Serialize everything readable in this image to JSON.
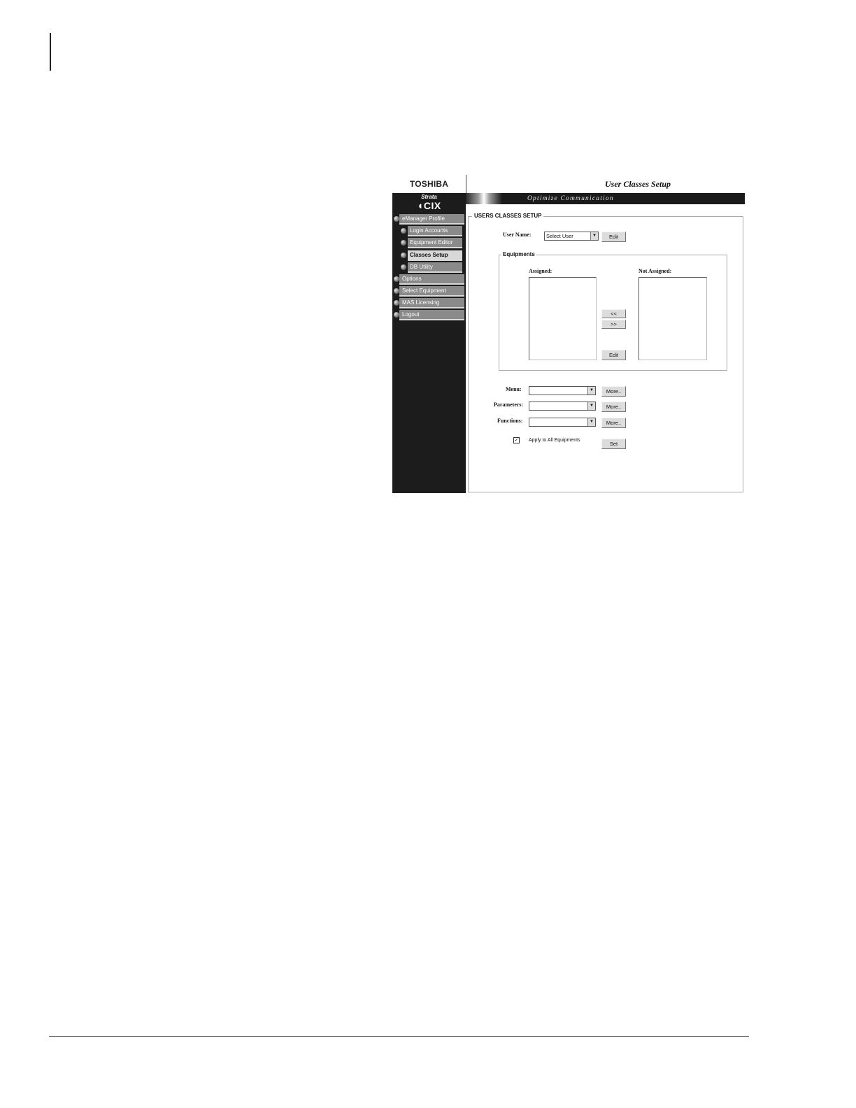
{
  "sidebar": {
    "brand_main": "TOSHIBA",
    "brand_strata": "Strata",
    "brand_cix": "CIX",
    "items": [
      {
        "label": "eManager Profile",
        "level": "top"
      },
      {
        "label": "Login Accounts",
        "level": "sub"
      },
      {
        "label": "Equipment Editor",
        "level": "sub"
      },
      {
        "label": "Classes Setup",
        "level": "sub",
        "active": true
      },
      {
        "label": "DB Utility",
        "level": "sub"
      },
      {
        "label": "Options",
        "level": "top"
      },
      {
        "label": "Select Equipment",
        "level": "top"
      },
      {
        "label": "MAS Licensing",
        "level": "top"
      },
      {
        "label": "Logout",
        "level": "top"
      }
    ]
  },
  "header": {
    "title": "User Classes Setup",
    "tagline": "Optimize Communication"
  },
  "panel": {
    "legend": "USERS CLASSES SETUP",
    "user_name_label": "User Name:",
    "user_select_value": "Select User",
    "edit_label": "Edit",
    "equipments_legend": "Equipments",
    "assigned_label": "Assigned:",
    "not_assigned_label": "Not Assigned:",
    "move_left_label": "<<",
    "move_right_label": ">>",
    "equip_edit_label": "Edit",
    "menu_label": "Menu:",
    "parameters_label": "Parameters:",
    "functions_label": "Functions:",
    "more_label": "More..",
    "apply_all_label": "Apply to All Equipments",
    "apply_all_checked": true,
    "set_label": "Set"
  }
}
